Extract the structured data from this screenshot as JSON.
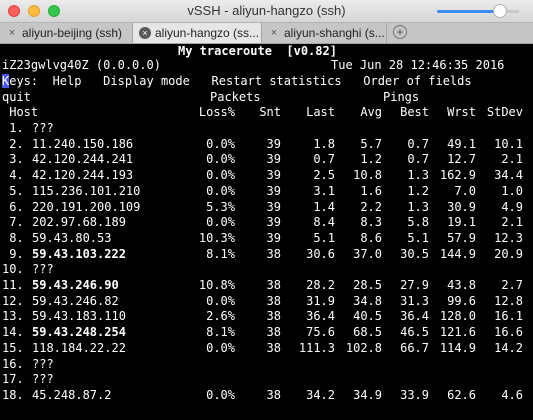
{
  "window": {
    "title": "vSSH - aliyun-hangzo (ssh)"
  },
  "tabs": [
    {
      "label": "aliyun-beijing (ssh)",
      "close": "×"
    },
    {
      "label": "aliyun-hangzo (ss...",
      "close": "×"
    },
    {
      "label": "aliyun-shanghi (s...",
      "close": "×"
    }
  ],
  "add_tab": "+",
  "font_slider_percent": 77,
  "terminal": {
    "header": "My traceroute  [v0.82]",
    "hostline_left": "iZ23gwlvg40Z (0.0.0.0)",
    "hostline_right": "Tue Jun 28 12:46:35 2016",
    "keys_cursor": "K",
    "keys_rest": "eys:  Help   Display mode   Restart statistics   Order of fields",
    "quit": "quit",
    "group_packets": "Packets",
    "group_pings": "Pings",
    "col_host": " Host",
    "col_loss": "Loss%",
    "col_snt": "Snt",
    "col_last": "Last",
    "col_avg": "Avg",
    "col_best": "Best",
    "col_wrst": "Wrst",
    "col_stdev": "StDev",
    "hops": [
      {
        "num": " 1.",
        "host": "???",
        "loss": "",
        "snt": "",
        "last": "",
        "avg": "",
        "best": "",
        "wrst": "",
        "stdev": "",
        "bold": false
      },
      {
        "num": " 2.",
        "host": "11.240.150.186",
        "loss": "0.0%",
        "snt": "39",
        "last": "1.8",
        "avg": "5.7",
        "best": "0.7",
        "wrst": "49.1",
        "stdev": "10.1",
        "bold": false
      },
      {
        "num": " 3.",
        "host": "42.120.244.241",
        "loss": "0.0%",
        "snt": "39",
        "last": "0.7",
        "avg": "1.2",
        "best": "0.7",
        "wrst": "12.7",
        "stdev": "2.1",
        "bold": false
      },
      {
        "num": " 4.",
        "host": "42.120.244.193",
        "loss": "0.0%",
        "snt": "39",
        "last": "2.5",
        "avg": "10.8",
        "best": "1.3",
        "wrst": "162.9",
        "stdev": "34.4",
        "bold": false
      },
      {
        "num": " 5.",
        "host": "115.236.101.210",
        "loss": "0.0%",
        "snt": "39",
        "last": "3.1",
        "avg": "1.6",
        "best": "1.2",
        "wrst": "7.0",
        "stdev": "1.0",
        "bold": false
      },
      {
        "num": " 6.",
        "host": "220.191.200.109",
        "loss": "5.3%",
        "snt": "39",
        "last": "1.4",
        "avg": "2.2",
        "best": "1.3",
        "wrst": "30.9",
        "stdev": "4.9",
        "bold": false
      },
      {
        "num": " 7.",
        "host": "202.97.68.189",
        "loss": "0.0%",
        "snt": "39",
        "last": "8.4",
        "avg": "8.3",
        "best": "5.8",
        "wrst": "19.1",
        "stdev": "2.1",
        "bold": false
      },
      {
        "num": " 8.",
        "host": "59.43.80.53",
        "loss": "10.3%",
        "snt": "39",
        "last": "5.1",
        "avg": "8.6",
        "best": "5.1",
        "wrst": "57.9",
        "stdev": "12.3",
        "bold": false
      },
      {
        "num": " 9.",
        "host": "59.43.103.222",
        "loss": "8.1%",
        "snt": "38",
        "last": "30.6",
        "avg": "37.0",
        "best": "30.5",
        "wrst": "144.9",
        "stdev": "20.9",
        "bold": true
      },
      {
        "num": "10.",
        "host": "???",
        "loss": "",
        "snt": "",
        "last": "",
        "avg": "",
        "best": "",
        "wrst": "",
        "stdev": "",
        "bold": false
      },
      {
        "num": "11.",
        "host": "59.43.246.90",
        "loss": "10.8%",
        "snt": "38",
        "last": "28.2",
        "avg": "28.5",
        "best": "27.9",
        "wrst": "43.8",
        "stdev": "2.7",
        "bold": true
      },
      {
        "num": "12.",
        "host": "59.43.246.82",
        "loss": "0.0%",
        "snt": "38",
        "last": "31.9",
        "avg": "34.8",
        "best": "31.3",
        "wrst": "99.6",
        "stdev": "12.8",
        "bold": false
      },
      {
        "num": "13.",
        "host": "59.43.183.110",
        "loss": "2.6%",
        "snt": "38",
        "last": "36.4",
        "avg": "40.5",
        "best": "36.4",
        "wrst": "128.0",
        "stdev": "16.1",
        "bold": false
      },
      {
        "num": "14.",
        "host": "59.43.248.254",
        "loss": "8.1%",
        "snt": "38",
        "last": "75.6",
        "avg": "68.5",
        "best": "46.5",
        "wrst": "121.6",
        "stdev": "16.6",
        "bold": true
      },
      {
        "num": "15.",
        "host": "118.184.22.22",
        "loss": "0.0%",
        "snt": "38",
        "last": "111.3",
        "avg": "102.8",
        "best": "66.7",
        "wrst": "114.9",
        "stdev": "14.2",
        "bold": false
      },
      {
        "num": "16.",
        "host": "???",
        "loss": "",
        "snt": "",
        "last": "",
        "avg": "",
        "best": "",
        "wrst": "",
        "stdev": "",
        "bold": false
      },
      {
        "num": "17.",
        "host": "???",
        "loss": "",
        "snt": "",
        "last": "",
        "avg": "",
        "best": "",
        "wrst": "",
        "stdev": "",
        "bold": false
      },
      {
        "num": "18.",
        "host": "45.248.87.2",
        "loss": "0.0%",
        "snt": "38",
        "last": "34.2",
        "avg": "34.9",
        "best": "33.9",
        "wrst": "62.6",
        "stdev": "4.6",
        "bold": false
      }
    ]
  }
}
